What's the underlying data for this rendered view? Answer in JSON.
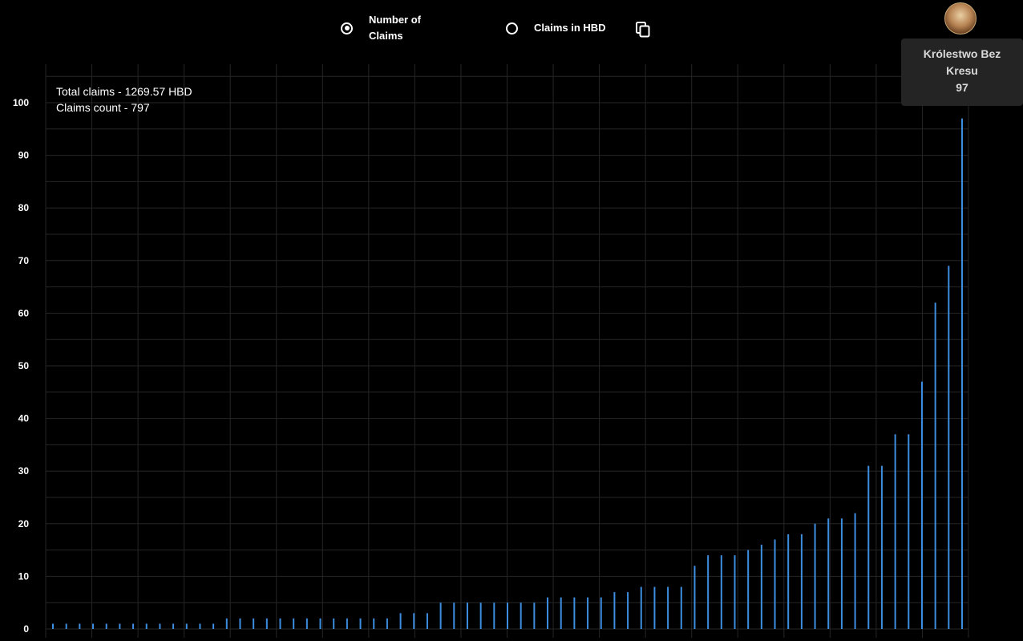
{
  "controls": {
    "radio_count_label": "Number of Claims",
    "radio_hbd_label": "Claims in HBD",
    "selected": "count",
    "copy_icon": "copy-icon"
  },
  "summary": {
    "total_claims": "Total claims - 1269.57 HBD",
    "claims_count": "Claims count - 797"
  },
  "tooltip": {
    "name": "Królestwo Bez Kresu",
    "value": "97"
  },
  "colors": {
    "bar": "#3d8ee0",
    "grid": "#262626",
    "background": "#000000"
  },
  "chart_data": {
    "type": "bar",
    "ylim": [
      0,
      100
    ],
    "yticks": [
      0,
      10,
      20,
      30,
      40,
      50,
      60,
      70,
      80,
      90,
      100
    ],
    "grid": true,
    "values": [
      1,
      1,
      1,
      1,
      1,
      1,
      1,
      1,
      1,
      1,
      1,
      1,
      1,
      2,
      2,
      2,
      2,
      2,
      2,
      2,
      2,
      2,
      2,
      2,
      2,
      2,
      3,
      3,
      3,
      5,
      5,
      5,
      5,
      5,
      5,
      5,
      5,
      6,
      6,
      6,
      6,
      6,
      7,
      7,
      8,
      8,
      8,
      8,
      12,
      14,
      14,
      14,
      15,
      16,
      17,
      18,
      18,
      20,
      21,
      21,
      22,
      31,
      31,
      37,
      37,
      47,
      62,
      69,
      97
    ]
  }
}
